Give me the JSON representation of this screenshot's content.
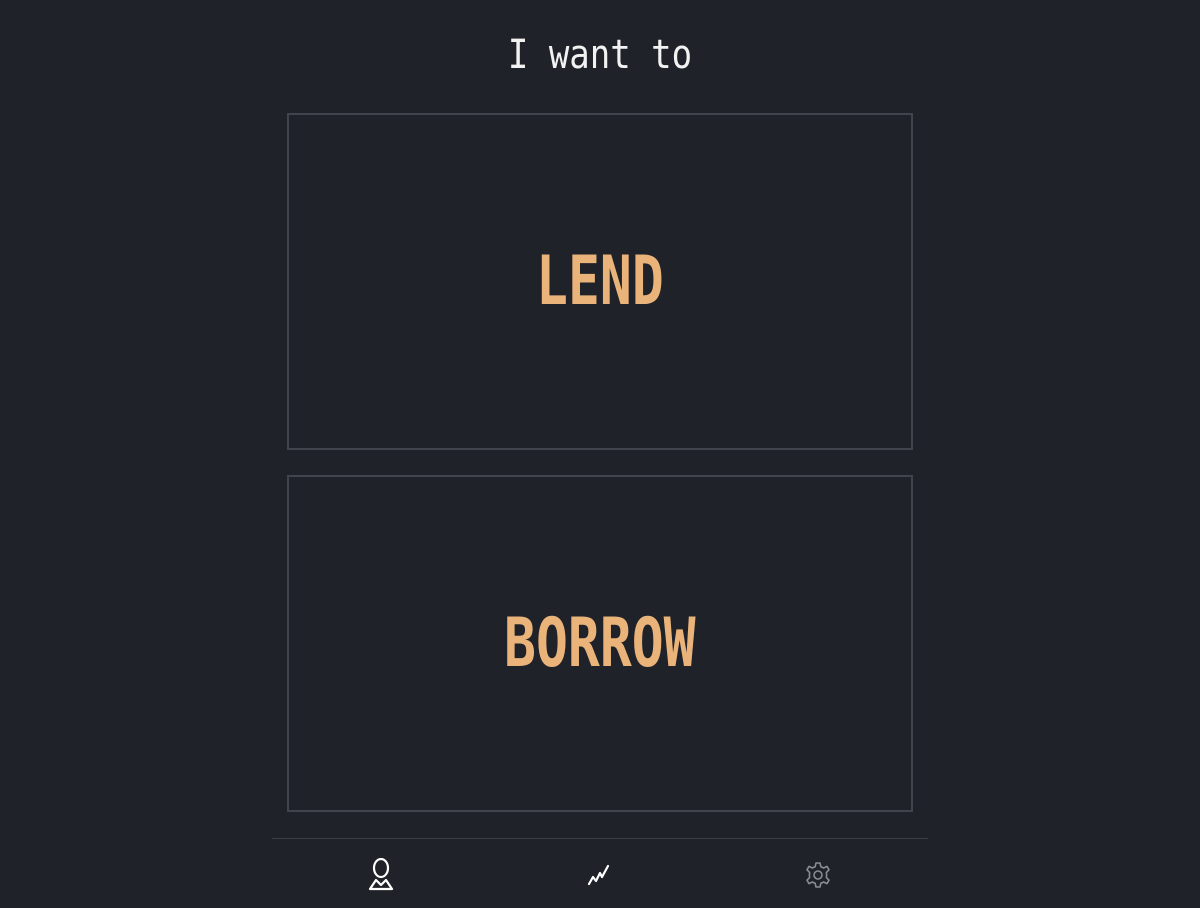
{
  "heading": {
    "text": "I want to"
  },
  "options": {
    "lend_label": "LEND",
    "borrow_label": "BORROW"
  },
  "nav": {
    "items": [
      {
        "icon": "profile-icon"
      },
      {
        "icon": "stats-icon"
      },
      {
        "icon": "settings-icon"
      }
    ]
  },
  "colors": {
    "background": "#1f2228",
    "border": "#40454d",
    "accent": "#eab37a",
    "text": "#f2f2f2",
    "icon_active": "#ffffff",
    "icon_muted": "#8a8e94"
  }
}
